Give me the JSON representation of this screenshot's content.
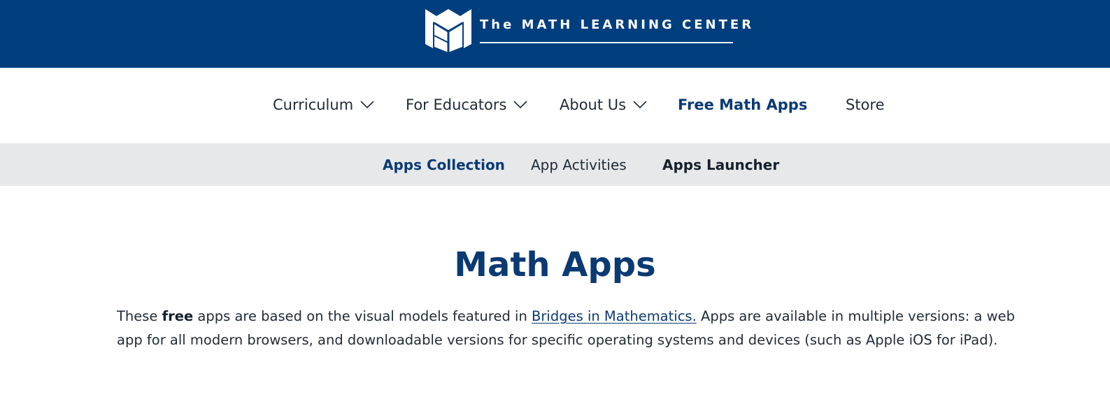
{
  "brand": {
    "logo_text": "The MATH LEARNING CENTER",
    "bar_color": "#003e7e",
    "logo_icon": "cube-logo-icon"
  },
  "main_nav": {
    "items": [
      {
        "label": "Curriculum",
        "has_dropdown": true
      },
      {
        "label": "For Educators",
        "has_dropdown": true
      },
      {
        "label": "About Us",
        "has_dropdown": true
      },
      {
        "label": "Free Math Apps",
        "has_dropdown": false,
        "active": true
      },
      {
        "label": "Store",
        "has_dropdown": false
      }
    ]
  },
  "sub_nav": {
    "items": [
      {
        "label": "Apps Collection"
      },
      {
        "label": "App Activities"
      },
      {
        "label": "Apps Launcher"
      }
    ],
    "background": "#e7e8ea"
  },
  "content": {
    "title": "Math Apps",
    "intro": {
      "part1": "These ",
      "bold": "free",
      "part2": " apps are based on the visual models featured in ",
      "link": "Bridges in Mathematics.",
      "part3": " Apps are available in multiple versions: a web app for all modern browsers, and downloadable versions for specific operating systems and devices (such as Apple iOS for iPad)."
    },
    "accent_color": "#0b3a73"
  }
}
